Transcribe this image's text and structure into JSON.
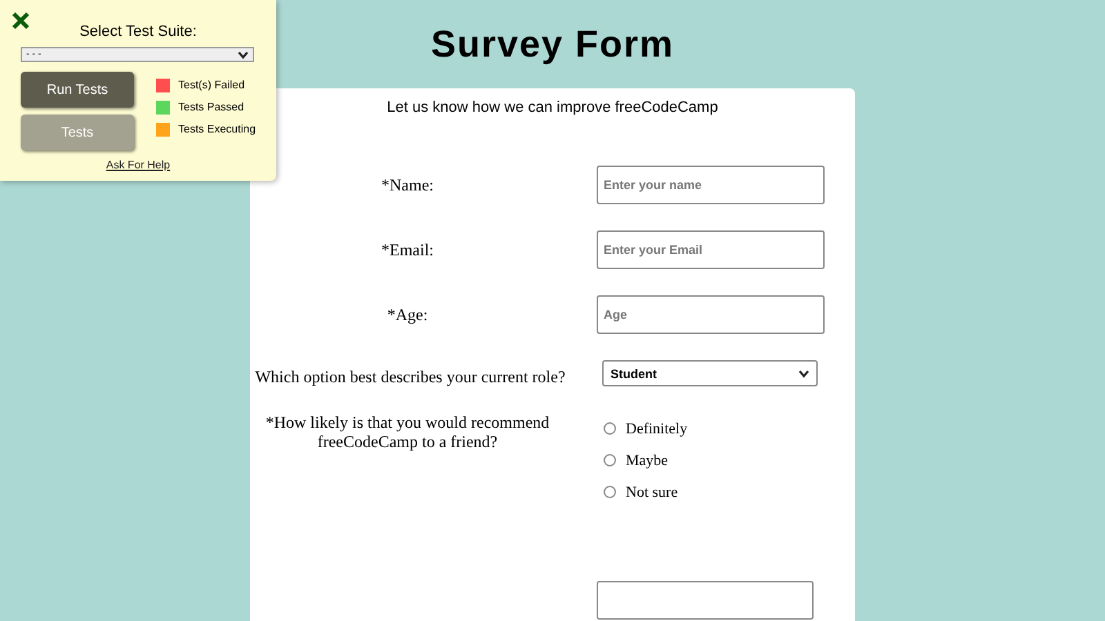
{
  "page": {
    "title": "Survey Form"
  },
  "test_panel": {
    "heading": "Select Test Suite:",
    "suite_select": {
      "value": "- - -"
    },
    "buttons": [
      "Run Tests",
      "Tests"
    ],
    "legend": [
      {
        "label": "Test(s) Failed",
        "color": "#ff4e4e"
      },
      {
        "label": "Tests Passed",
        "color": "#5cd65c"
      },
      {
        "label": "Tests Executing",
        "color": "#ffa31a"
      }
    ],
    "help_link": "Ask For Help"
  },
  "form": {
    "description": "Let us know how we can improve freeCodeCamp",
    "fields": [
      {
        "kind": "text",
        "label": "*Name:",
        "placeholder": "Enter your name"
      },
      {
        "kind": "text",
        "label": "*Email:",
        "placeholder": "Enter your Email"
      },
      {
        "kind": "text",
        "label": "*Age:",
        "placeholder": "Age"
      },
      {
        "kind": "select",
        "label": "Which option best describes your current role?",
        "value": "Student"
      },
      {
        "kind": "radio",
        "label": "*How likely is that you would recommend freeCodeCamp to a friend?",
        "options": [
          {
            "label": "Definitely",
            "selected": false
          },
          {
            "label": "Maybe",
            "selected": false
          },
          {
            "label": "Not sure",
            "selected": false
          }
        ]
      },
      {
        "kind": "partial"
      }
    ]
  }
}
